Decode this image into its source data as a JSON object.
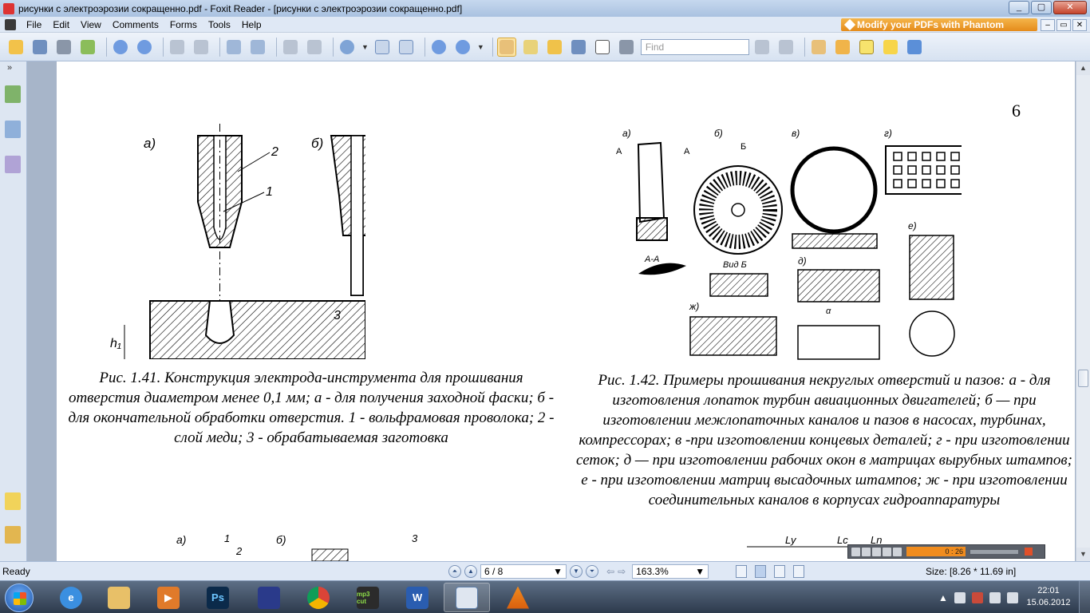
{
  "window": {
    "title": "рисунки с электроэрозии сокращенно.pdf - Foxit Reader - [рисунки с электроэрозии сокращенно.pdf]",
    "minimize": "_",
    "maximize": "▢",
    "close": "✕"
  },
  "menubar": {
    "items": [
      "File",
      "Edit",
      "View",
      "Comments",
      "Forms",
      "Tools",
      "Help"
    ],
    "promo": "Modify your PDFs with Phantom",
    "mdi": [
      "–",
      "▭",
      "✕"
    ]
  },
  "toolbar": {
    "find_placeholder": "Find"
  },
  "document": {
    "page_number": "6",
    "fig41_caption": "Рис. 1.41. Конструкция электрода-инструмента для прошивания отверстия диаметром менее 0,1 мм; а - для получения заходной фаски; б - для окончательной обработки отверстия. 1 - вольфрамовая проволока; 2 - слой меди; 3 - обрабатываемая заготовка",
    "fig42_caption": "Рис. 1.42. Примеры прошивания некруглых отверстий и пазов: а - для изготовления лопаток турбин авиационных двигателей; б — при изготовлении межлопаточных каналов и пазов в насосах, турбинах, компрессорах; в -при изготовлении концевых деталей; г - при изготовлении сеток; д — при изготовлении рабочих окон в матрицах вырубных штампов; е - при изготовлении матриц высадочных штампов; ж - при изготовлении соединительных каналов в корпусах гидроаппаратуры",
    "fig41_labels": {
      "a": "а)",
      "b": "б)",
      "l1": "1",
      "l2": "2",
      "l3": "3",
      "h": "h",
      "h1": "h₁",
      "l1b": "1",
      "l2b": "2"
    },
    "fig42_labels": {
      "a": "а)",
      "b": "б)",
      "v": "в)",
      "g": "г)",
      "d": "д)",
      "e": "е)",
      "zh": "ж)",
      "A1": "А",
      "A2": "А",
      "AA": "А-А",
      "B": "Б",
      "vid_b": "Вид Б",
      "alpha": "α"
    },
    "next_fig_labels": {
      "a": "а)",
      "l1": "1",
      "l2": "2",
      "b": "б)",
      "l3": "3",
      "ly": "Ly",
      "lc": "Lc",
      "ln": "Ln"
    }
  },
  "player": {
    "time": "0 : 26"
  },
  "statusbar": {
    "ready": "Ready",
    "page": "6 / 8",
    "zoom": "163.3%",
    "size": "Size: [8.26 * 11.69 in]"
  },
  "taskbar": {
    "time": "22:01",
    "date": "15.06.2012",
    "ps_label": "Ps",
    "mp3_label": "mp3 cut",
    "word_label": "W"
  }
}
